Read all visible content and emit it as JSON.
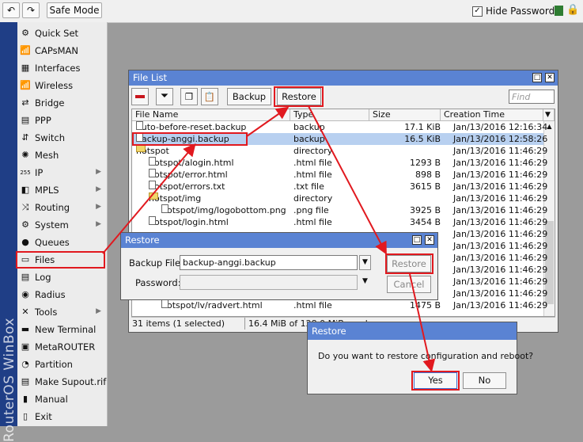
{
  "toolbar": {
    "undo_icon": "undo-icon",
    "redo_icon": "redo-icon",
    "safe_mode": "Safe Mode",
    "hide_passwords": "Hide Passwords"
  },
  "sidebar": {
    "brand": "RouterOS WinBox",
    "items": [
      {
        "label": "Quick Set",
        "icon": "⚙",
        "arrow": false
      },
      {
        "label": "CAPsMAN",
        "icon": "📶",
        "arrow": false
      },
      {
        "label": "Interfaces",
        "icon": "▦",
        "arrow": false
      },
      {
        "label": "Wireless",
        "icon": "📶",
        "arrow": false
      },
      {
        "label": "Bridge",
        "icon": "⇄",
        "arrow": false
      },
      {
        "label": "PPP",
        "icon": "▤",
        "arrow": false
      },
      {
        "label": "Switch",
        "icon": "⇵",
        "arrow": false
      },
      {
        "label": "Mesh",
        "icon": "✺",
        "arrow": false
      },
      {
        "label": "IP",
        "icon": "255",
        "arrow": true
      },
      {
        "label": "MPLS",
        "icon": "◧",
        "arrow": true
      },
      {
        "label": "Routing",
        "icon": "⤨",
        "arrow": true
      },
      {
        "label": "System",
        "icon": "⚙",
        "arrow": true
      },
      {
        "label": "Queues",
        "icon": "●",
        "arrow": false
      },
      {
        "label": "Files",
        "icon": "▭",
        "arrow": false
      },
      {
        "label": "Log",
        "icon": "▤",
        "arrow": false
      },
      {
        "label": "Radius",
        "icon": "◉",
        "arrow": false
      },
      {
        "label": "Tools",
        "icon": "✕",
        "arrow": true
      },
      {
        "label": "New Terminal",
        "icon": "▬",
        "arrow": false
      },
      {
        "label": "MetaROUTER",
        "icon": "▣",
        "arrow": false
      },
      {
        "label": "Partition",
        "icon": "◔",
        "arrow": false
      },
      {
        "label": "Make Supout.rif",
        "icon": "▤",
        "arrow": false
      },
      {
        "label": "Manual",
        "icon": "▮",
        "arrow": false
      },
      {
        "label": "Exit",
        "icon": "▯",
        "arrow": false
      }
    ]
  },
  "file_list": {
    "title": "File List",
    "backup_btn": "Backup",
    "restore_btn": "Restore",
    "find_placeholder": "Find",
    "columns": [
      "File Name",
      "Type",
      "Size",
      "Creation Time"
    ],
    "rows": [
      {
        "name": "auto-before-reset.backup",
        "type": "backup",
        "size": "17.1 KiB",
        "date": "Jan/13/2016 12:16:34",
        "kind": "file",
        "indent": 0
      },
      {
        "name": "backup-anggi.backup",
        "type": "backup",
        "size": "16.5 KiB",
        "date": "Jan/13/2016 12:58:26",
        "kind": "file",
        "indent": 0
      },
      {
        "name": "hotspot",
        "type": "directory",
        "size": "",
        "date": "Jan/13/2016 11:46:29",
        "kind": "folder",
        "indent": 0
      },
      {
        "name": "hotspot/alogin.html",
        "type": ".html file",
        "size": "1293 B",
        "date": "Jan/13/2016 11:46:29",
        "kind": "file",
        "indent": 1
      },
      {
        "name": "hotspot/error.html",
        "type": ".html file",
        "size": "898 B",
        "date": "Jan/13/2016 11:46:29",
        "kind": "file",
        "indent": 1
      },
      {
        "name": "hotspot/errors.txt",
        "type": ".txt file",
        "size": "3615 B",
        "date": "Jan/13/2016 11:46:29",
        "kind": "file",
        "indent": 1
      },
      {
        "name": "hotspot/img",
        "type": "directory",
        "size": "",
        "date": "Jan/13/2016 11:46:29",
        "kind": "folder",
        "indent": 1
      },
      {
        "name": "hotspot/img/logobottom.png",
        "type": ".png file",
        "size": "3925 B",
        "date": "Jan/13/2016 11:46:29",
        "kind": "file",
        "indent": 2
      },
      {
        "name": "hotspot/login.html",
        "type": ".html file",
        "size": "3454 B",
        "date": "Jan/13/2016 11:46:29",
        "kind": "file",
        "indent": 1
      },
      {
        "name": "",
        "type": "",
        "size": "",
        "date": "Jan/13/2016 11:46:29",
        "kind": "none",
        "indent": 1
      },
      {
        "name": "",
        "type": "",
        "size": "",
        "date": "Jan/13/2016 11:46:29",
        "kind": "none",
        "indent": 1
      },
      {
        "name": "",
        "type": "",
        "size": "",
        "date": "Jan/13/2016 11:46:29",
        "kind": "none",
        "indent": 1
      },
      {
        "name": "",
        "type": "",
        "size": "",
        "date": "Jan/13/2016 11:46:29",
        "kind": "none",
        "indent": 1
      },
      {
        "name": "",
        "type": "",
        "size": "",
        "date": "Jan/13/2016 11:46:29",
        "kind": "none",
        "indent": 1
      },
      {
        "name": "",
        "type": "",
        "size": "",
        "date": "Jan/13/2016 11:46:29",
        "kind": "none",
        "indent": 1
      },
      {
        "name": "hotspot/lv/radvert.html",
        "type": ".html file",
        "size": "1475 B",
        "date": "Jan/13/2016 11:46:29",
        "kind": "file",
        "indent": 2
      }
    ],
    "status_items": "31 items (1 selected)",
    "status_disk": "16.4 MiB of 128.0 MiB used"
  },
  "restore_dialog": {
    "title": "Restore",
    "backup_file_label": "Backup File:",
    "backup_file_value": "backup-anggi.backup",
    "password_label": "Password:",
    "restore_btn": "Restore",
    "cancel_btn": "Cancel"
  },
  "confirm_dialog": {
    "title": "Restore",
    "message": "Do you want to restore configuration and reboot?",
    "yes": "Yes",
    "no": "No"
  },
  "colors": {
    "titlebar": "#5a83d3",
    "selection": "#b8d0f0",
    "highlight": "#e1191f",
    "brand": "#1f3e86"
  }
}
